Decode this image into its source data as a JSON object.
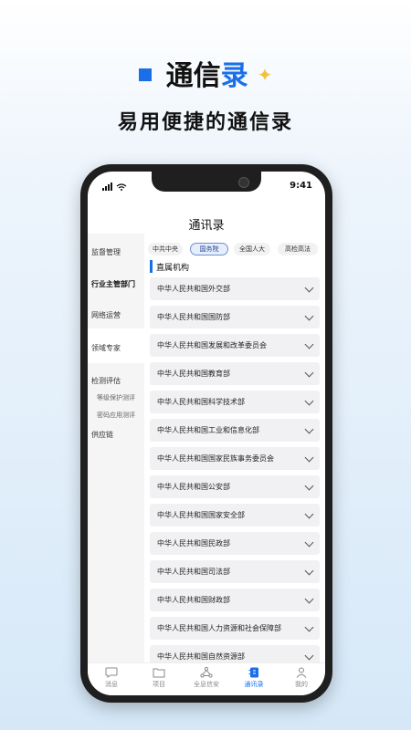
{
  "header": {
    "title_main": "通信",
    "title_accent": "录",
    "subtitle": "易用便捷的通信录"
  },
  "status_bar": {
    "time": "9:41"
  },
  "app": {
    "title": "通讯录"
  },
  "left_nav": [
    {
      "label": "监督管理",
      "active": false,
      "sub": false
    },
    {
      "label": "行业主管部门",
      "active": true,
      "sub": false
    },
    {
      "label": "网络运营",
      "active": false,
      "sub": false
    },
    {
      "label": "领域专家",
      "active": false,
      "sub": false
    },
    {
      "label": "检测评估",
      "active": false,
      "sub": false
    },
    {
      "label": "等级保护测评",
      "active": false,
      "sub": true
    },
    {
      "label": "密码应用测评",
      "active": false,
      "sub": true
    },
    {
      "label": "供应链",
      "active": false,
      "sub": false
    }
  ],
  "tabs": [
    {
      "label": "中共中央",
      "active": false
    },
    {
      "label": "国务院",
      "active": true
    },
    {
      "label": "全国人大",
      "active": false
    },
    {
      "label": "高检高法",
      "active": false
    }
  ],
  "section_title": "直属机构",
  "items": [
    "中华人民共和国外交部",
    "中华人民共和国国防部",
    "中华人民共和国发展和改革委员会",
    "中华人民共和国教育部",
    "中华人民共和国科学技术部",
    "中华人民共和国工业和信息化部",
    "中华人民共和国国家民族事务委员会",
    "中华人民共和国公安部",
    "中华人民共和国国家安全部",
    "中华人民共和国民政部",
    "中华人民共和国司法部",
    "中华人民共和国财政部",
    "中华人民共和国人力资源和社会保障部",
    "中华人民共和国自然资源部"
  ],
  "bottom_nav": [
    {
      "label": "消息",
      "icon": "chat-icon",
      "active": false
    },
    {
      "label": "项目",
      "icon": "folder-icon",
      "active": false
    },
    {
      "label": "全息信安",
      "icon": "network-icon",
      "active": false
    },
    {
      "label": "通讯录",
      "icon": "contacts-icon",
      "active": true
    },
    {
      "label": "我的",
      "icon": "user-icon",
      "active": false
    }
  ],
  "colors": {
    "accent": "#1a6fe8",
    "star": "#f3c23a"
  }
}
